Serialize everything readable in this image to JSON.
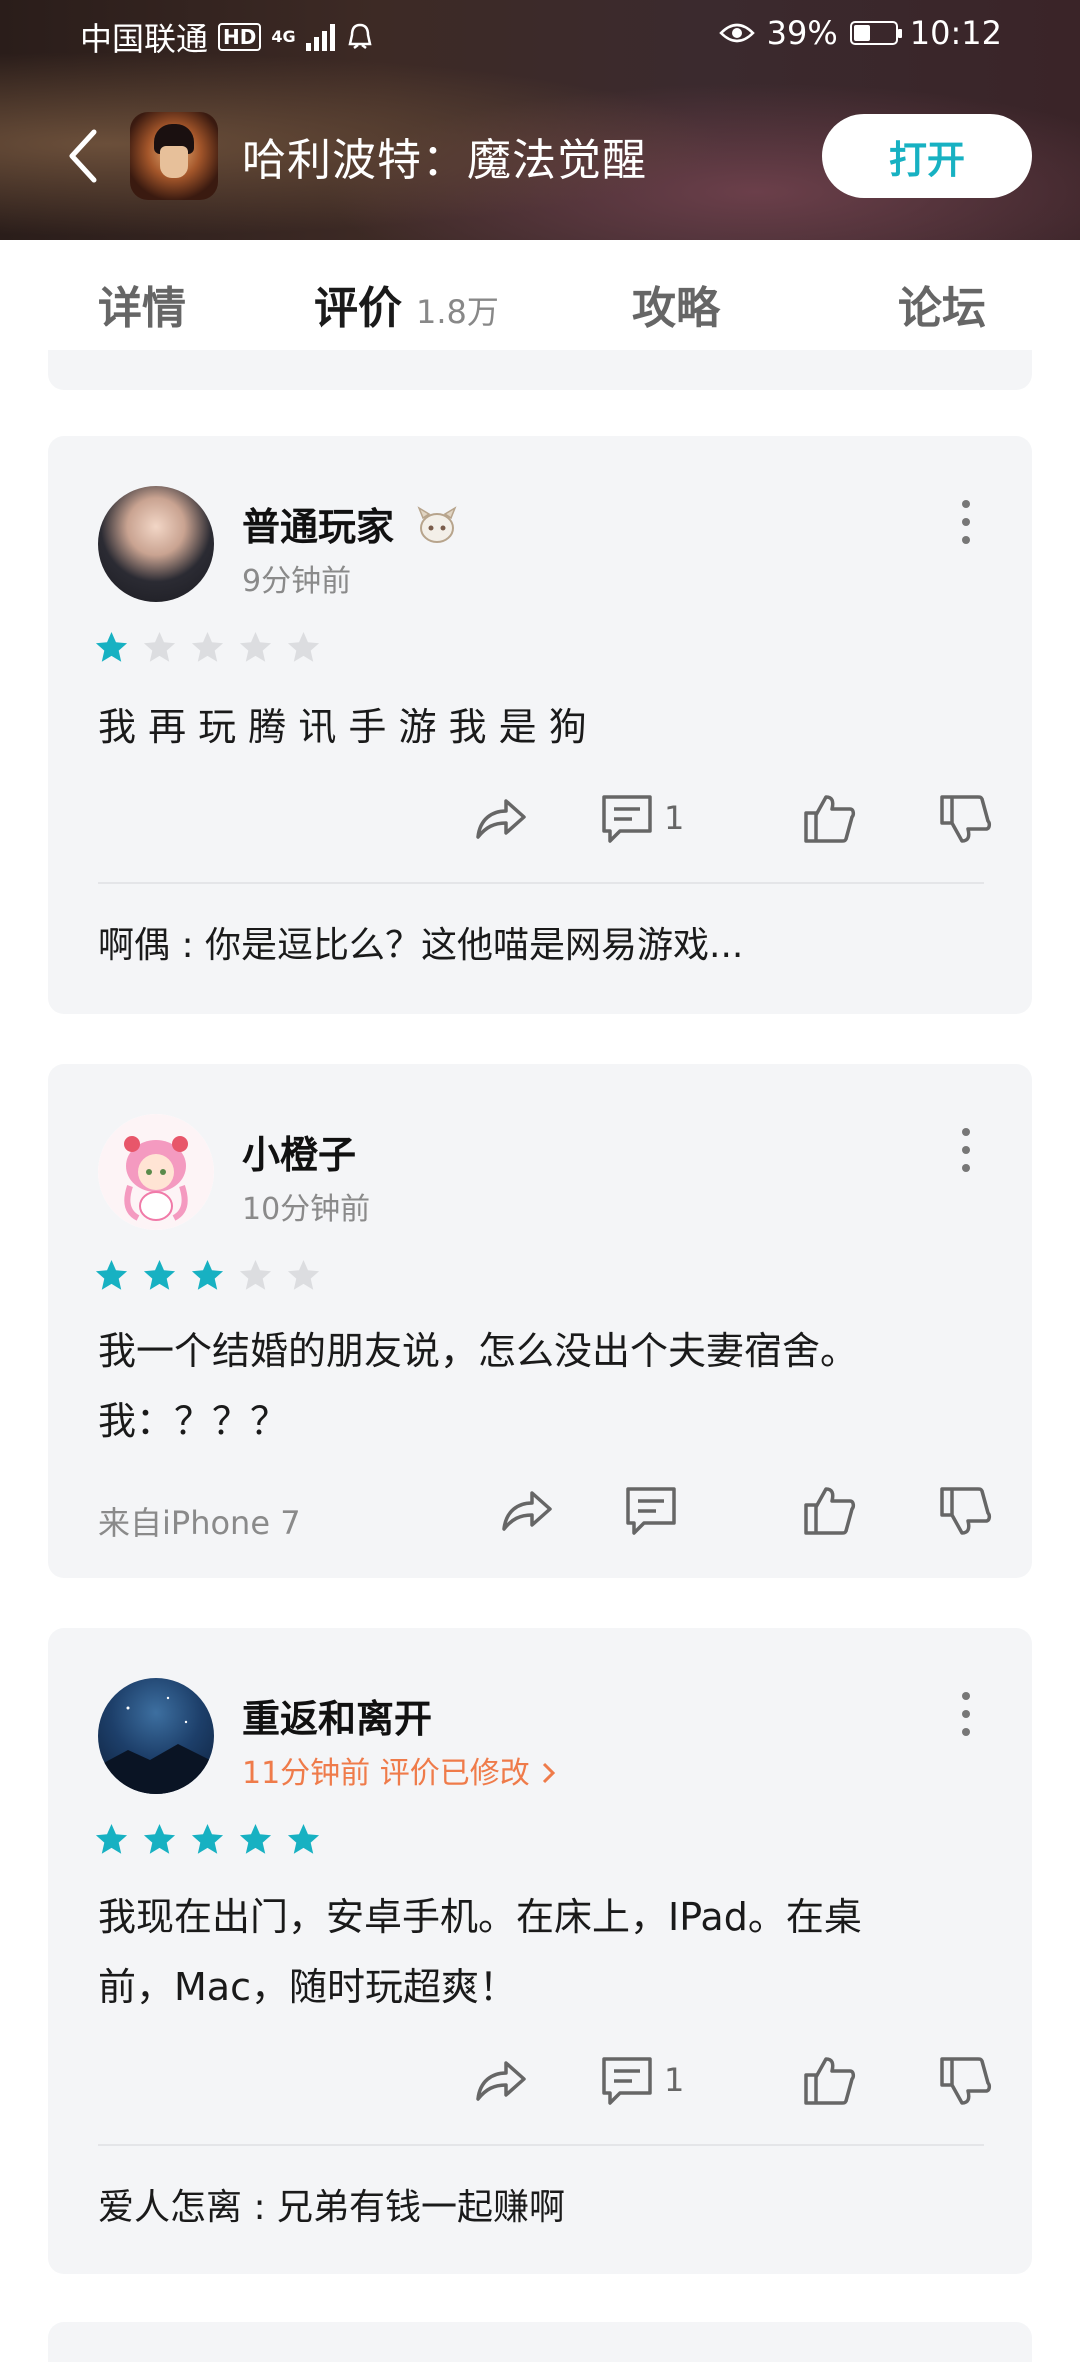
{
  "status_bar": {
    "carrier": "中国联通",
    "hd": "HD",
    "network": "4G",
    "battery_percent": "39%",
    "battery_level": 0.39,
    "time": "10:12",
    "icons": [
      "hd-icon",
      "signal-icon",
      "notification-icon",
      "eye-icon",
      "battery-icon"
    ]
  },
  "app_bar": {
    "title": "哈利波特：魔法觉醒",
    "open_button": "打开"
  },
  "tabs": [
    {
      "label": "详情"
    },
    {
      "label": "评价",
      "count": "1.8万",
      "active": true
    },
    {
      "label": "攻略"
    },
    {
      "label": "论坛"
    }
  ],
  "accent_color": "#17b1c2",
  "reviews": [
    {
      "user": "普通玩家",
      "time": "9分钟前",
      "rating": 1,
      "content": "我 再 玩 腾 讯 手 游 我 是 狗",
      "comments": "1",
      "reply": {
        "author": "啊偶",
        "sep": " : ",
        "text": "你是逗比么？这他喵是网易游戏..."
      }
    },
    {
      "user": "小橙子",
      "time": "10分钟前",
      "rating": 3,
      "content_line1": "我一个结婚的朋友说，怎么没出个夫妻宿舍。",
      "content_line2": "我：？？？",
      "device": "来自iPhone 7"
    },
    {
      "user": "重返和离开",
      "time": "11分钟前",
      "edited": "评价已修改",
      "rating": 5,
      "content_line1": "我现在出门，安卓手机。在床上，IPad。在桌",
      "content_line2": "前，Mac，随时玩超爽！",
      "comments": "1",
      "reply": {
        "author": "爱人怎离",
        "sep": " : ",
        "text": "兄弟有钱一起赚啊"
      }
    }
  ]
}
